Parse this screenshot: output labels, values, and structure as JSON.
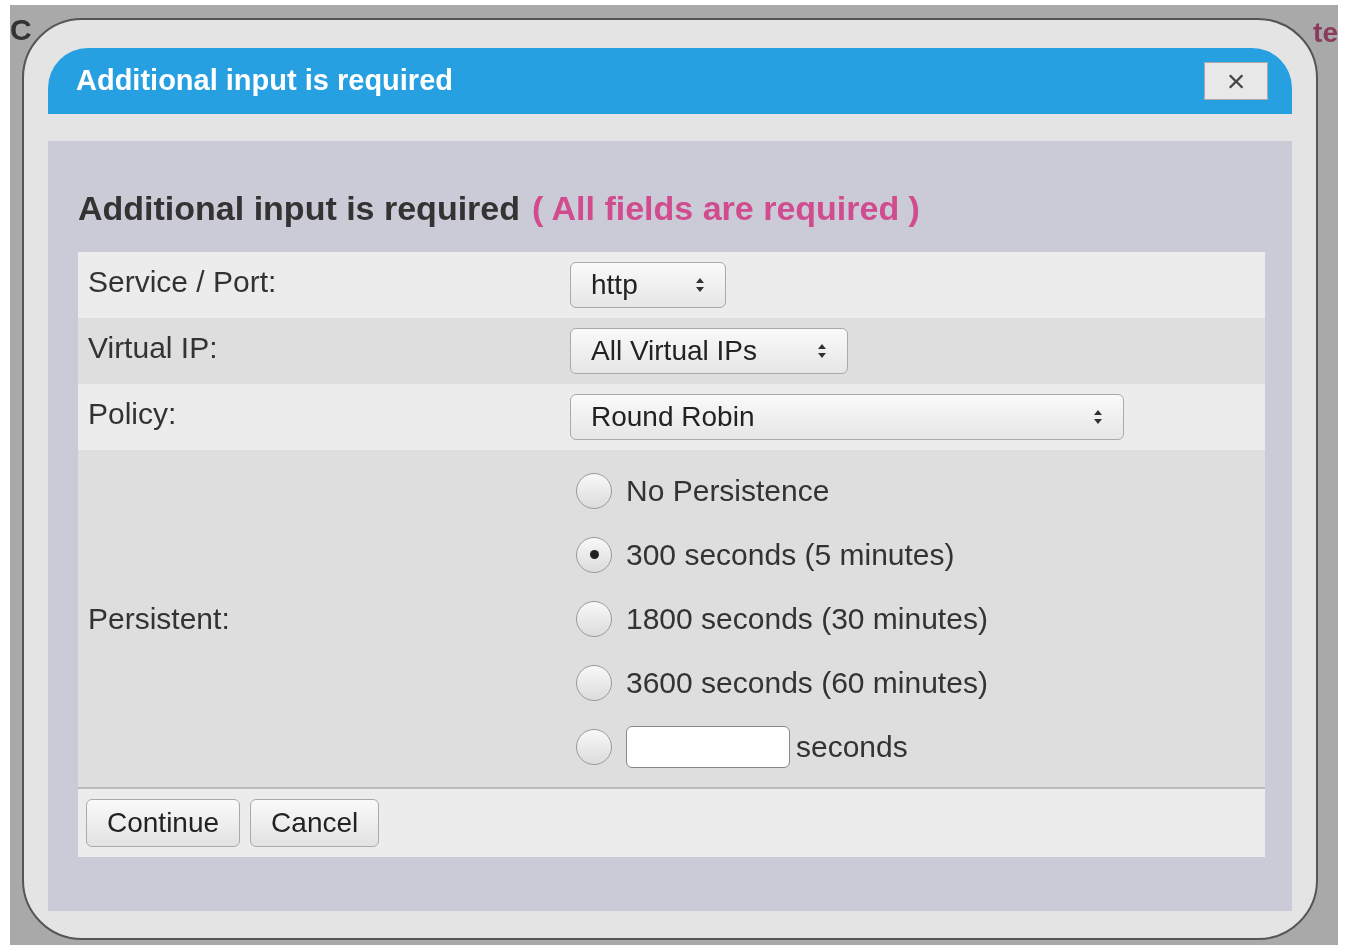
{
  "background": {
    "texts": [
      "C",
      "te"
    ]
  },
  "dialog": {
    "title": "Additional input is required",
    "close": "×",
    "heading": "Additional input is required",
    "required_note": "( All fields are required )",
    "fields": [
      {
        "kind": "select",
        "label": "Service / Port:",
        "value": "http"
      },
      {
        "kind": "select",
        "label": "Virtual IP:",
        "value": "All Virtual IPs"
      },
      {
        "kind": "select",
        "label": "Policy:",
        "value": "Round Robin"
      },
      {
        "kind": "radios",
        "label": "Persistent:",
        "options": [
          {
            "kind": "option",
            "label": "No Persistence",
            "selected": false
          },
          {
            "kind": "option",
            "label": "300 seconds (5 minutes)",
            "selected": true
          },
          {
            "kind": "option",
            "label": "1800 seconds (30 minutes)",
            "selected": false
          },
          {
            "kind": "option",
            "label": "3600 seconds (60 minutes)",
            "selected": false
          },
          {
            "kind": "custom",
            "label": "seconds",
            "selected": false
          }
        ]
      }
    ],
    "buttons": [
      "Continue",
      "Cancel"
    ]
  }
}
